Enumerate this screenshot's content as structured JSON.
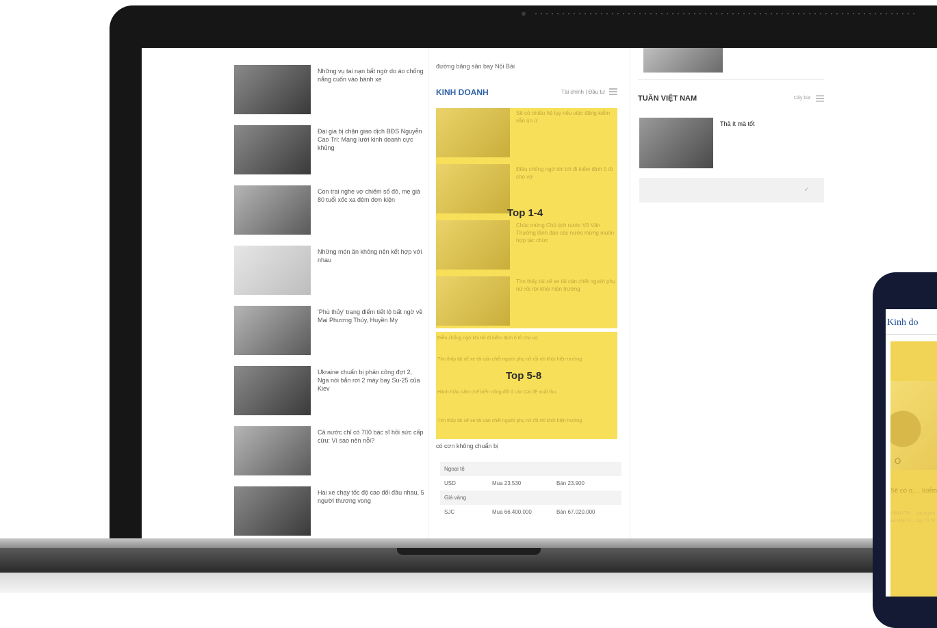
{
  "left_column": {
    "items": [
      {
        "title": "Những vụ tai nạn bất ngờ do áo chống nắng cuốn vào bánh xe"
      },
      {
        "title": "Đại gia bị chặn giao dịch BĐS Nguyễn Cao Trí: Mạng lưới kinh doanh cực khủng"
      },
      {
        "title": "Con trai nghe vợ chiếm sổ đỏ, mẹ già 80 tuổi xốc xa đêm đơn kiện"
      },
      {
        "title": "Những món ăn không nên kết hợp với nhau"
      },
      {
        "title": "'Phù thủy' trang điểm tiết lộ bất ngờ về Mai Phương Thúy, Huyền My"
      },
      {
        "title": "Ukraine chuẩn bị phản công đợt 2, Nga nói bắn rơi 2 máy bay Su-25 của Kiev"
      },
      {
        "title": "Cả nước chỉ có 700 bác sĩ hồi sức cấp cứu: Vì sao nên nỗi?"
      },
      {
        "title": "Hai xe chạy tốc độ cao đối đầu nhau, 5 người thương vong"
      }
    ]
  },
  "middle_column": {
    "prev_tail": "đường băng sân bay Nội Bài",
    "section_name": "KINH DOANH",
    "section_sub": "Tài chính | Đầu tư",
    "top_label_1": "Top 1-4",
    "top_label_2": "Top 5-8",
    "top_items": [
      {
        "title": "Sẽ có nhiều hệ lụy nếu việc đăng kiểm vẫn ùn ứ"
      },
      {
        "title": "Điều chống ngớ khi tới đi kiểm định ô tô cho vợ"
      },
      {
        "title": "Chúc mừng Chủ tịch nước Võ Văn Thưởng lãnh đạo các nước mừng muôn hợp tác chức"
      },
      {
        "title": "Tìm thấy tài xế xe tải cán chết người phụ nữ rồi rời khỏi hiện trường"
      }
    ],
    "more_items": [
      {
        "title": "Điều chống ngớ khi tới đi kiểm định ô tô cho vợ"
      },
      {
        "title": "Tìm thấy tài xế xe tải cán chết người phụ nữ rồi rời khỏi hiện trường"
      },
      {
        "title": "Hành thầu năm chế biến nông đối tỉ Lào Cai đề xuất thu"
      },
      {
        "title": "Tìm thấy tài xế xe tải cán chết người phụ nữ rồi rời khỏi hiện trường"
      }
    ],
    "cutoff_text": "có cơn không chuẩn bị",
    "rates": {
      "forex_label": "Ngoại tệ",
      "usd": {
        "code": "USD",
        "buy": "Mua 23.530",
        "sell": "Bán 23.900"
      },
      "gold_label": "Giá vàng",
      "sjc": {
        "code": "SJC",
        "buy": "Mua 66.400.000",
        "sell": "Bán 67.020.000"
      }
    }
  },
  "right_column": {
    "section_name": "TUẦN VIỆT NAM",
    "section_sub": "Cây bút",
    "article_title": "Thả ít mà tốt",
    "check_glyph": "✓"
  },
  "phone": {
    "section_title": "Kinh do",
    "headline": "Sẽ có n… kiểm vẫn…",
    "glyph": "O"
  }
}
